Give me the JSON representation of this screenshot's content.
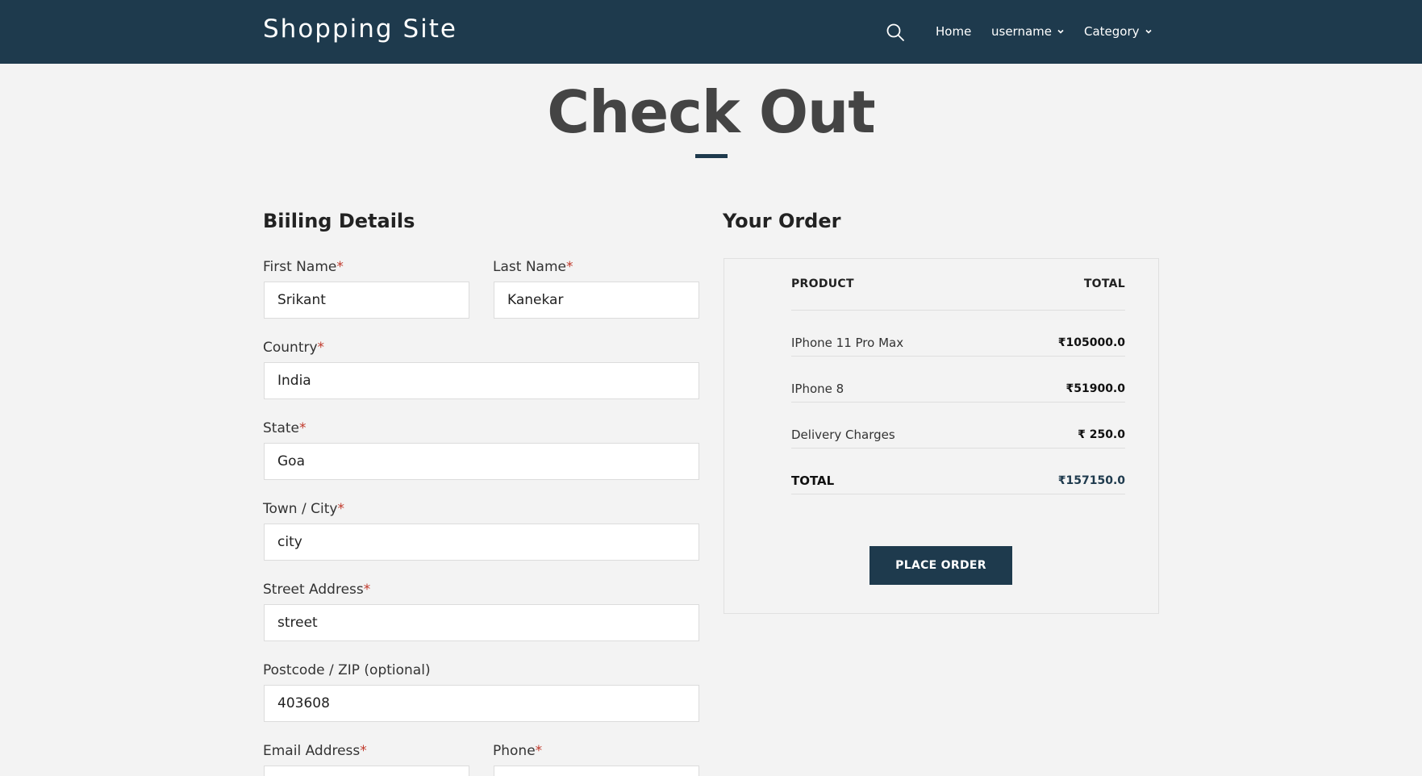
{
  "header": {
    "brand": "Shopping Site",
    "nav": {
      "home": "Home",
      "user": "username",
      "category": "Category"
    }
  },
  "page": {
    "title": "Check Out"
  },
  "billing": {
    "heading": "Biiling Details",
    "required_mark": "*",
    "fields": {
      "first_name": {
        "label": "First Name",
        "value": "Srikant"
      },
      "last_name": {
        "label": "Last Name",
        "value": "Kanekar"
      },
      "country": {
        "label": "Country",
        "value": "India"
      },
      "state": {
        "label": "State",
        "value": "Goa"
      },
      "city": {
        "label": "Town / City",
        "value": "city"
      },
      "street": {
        "label": "Street Address",
        "value": "street"
      },
      "postcode": {
        "label": "Postcode / ZIP (optional)",
        "value": "403608"
      },
      "email": {
        "label": "Email Address",
        "value": ""
      },
      "phone": {
        "label": "Phone",
        "value": ""
      }
    }
  },
  "order": {
    "heading": "Your Order",
    "col_product": "PRODUCT",
    "col_total": "TOTAL",
    "items": [
      {
        "name": "IPhone 11 Pro Max",
        "amount": "₹105000.0"
      },
      {
        "name": "IPhone 8",
        "amount": "₹51900.0"
      },
      {
        "name": "Delivery Charges",
        "amount": "₹ 250.0"
      }
    ],
    "total_label": "TOTAL",
    "total_amount": "₹157150.0",
    "place_order": "PLACE ORDER"
  },
  "colors": {
    "primary": "#1e3a4d",
    "background": "#f3f3f3",
    "required": "#c0392b"
  }
}
